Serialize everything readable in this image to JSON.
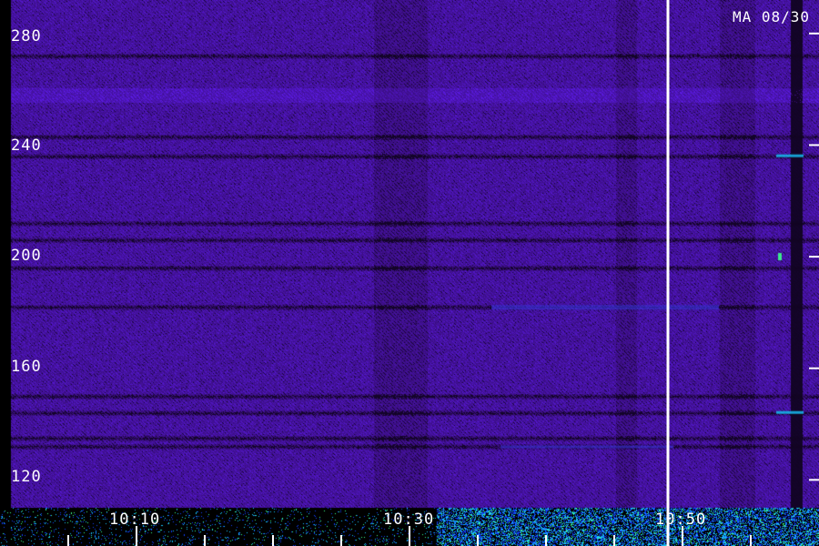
{
  "chart_data": {
    "type": "heatmap",
    "title": "MA 08/30",
    "xlabel": "",
    "ylabel": "",
    "x_tick_labels": [
      "10:10",
      "10:30",
      "10:50"
    ],
    "y_tick_labels": [
      "280",
      "240",
      "200",
      "160",
      "120"
    ],
    "y_ticks": [
      280,
      240,
      200,
      160,
      120
    ],
    "ylim": [
      110,
      292
    ],
    "colormap": [
      "#000000",
      "#2a0a5c",
      "#4a1aa8",
      "#3a2cff",
      "#18c8ff",
      "#3cff8a"
    ],
    "horizontal_bands": [
      {
        "y": 272,
        "kind": "dark"
      },
      {
        "y": 258,
        "kind": "bright"
      },
      {
        "y": 243,
        "kind": "dark"
      },
      {
        "y": 236,
        "kind": "dark"
      },
      {
        "y": 212,
        "kind": "dark"
      },
      {
        "y": 206,
        "kind": "dark"
      },
      {
        "y": 196,
        "kind": "dark"
      },
      {
        "y": 182,
        "kind": "dark"
      },
      {
        "y": 150,
        "kind": "dark"
      },
      {
        "y": 144,
        "kind": "dark"
      },
      {
        "y": 135,
        "kind": "dark"
      },
      {
        "y": 132,
        "kind": "dark"
      }
    ],
    "vertical_marker": "10:50",
    "grid": false,
    "legend": "none"
  }
}
